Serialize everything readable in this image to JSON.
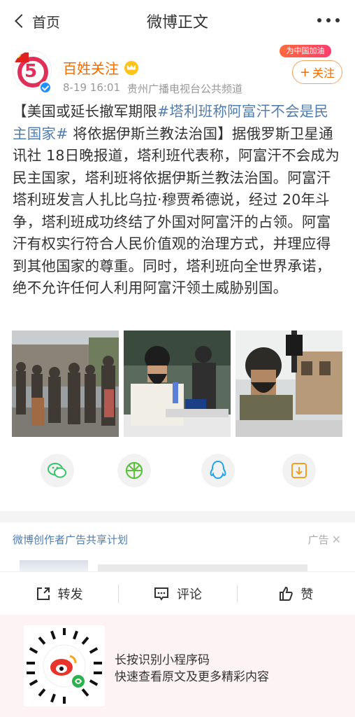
{
  "nav": {
    "back_label": "首页",
    "title": "微博正文"
  },
  "post": {
    "author": "百姓关注",
    "badge": "为中国加油",
    "follow_label": "关注",
    "date": "8-19 16:01",
    "source": "贵州广播电视台公共频道",
    "text_prefix": "【美国或延长撤军期限",
    "topic": "#塔利班称阿富汗不会是民主国家#",
    "text_body": " 将依据伊斯兰教法治国】据俄罗斯卫星通讯社 18日晚报道，塔利班代表称，阿富汗不会成为民主国家，塔利班将依据伊斯兰教法治国。阿富汗塔利班发言人扎比乌拉·穆贾希德说，经过 20年斗争，塔利班成功终结了外国对阿富汗的占领。阿富汗有权实行符合人民价值观的治理方式，并理应得到其他国家的尊重。同时，塔利班向全世界承诺，绝不允许任何人利用阿富汗领土威胁别国。",
    "share_icons": [
      "wechat-icon",
      "moments-icon",
      "qq-icon",
      "save-image-icon"
    ]
  },
  "ad": {
    "label": "微博创作者广告共享计划",
    "tag": "广告"
  },
  "actions": {
    "repost": "转发",
    "comment": "评论",
    "like": "赞"
  },
  "footer": {
    "line1": "长按识别小程序码",
    "line2": "快速查看原文及更多精彩内容"
  },
  "colors": {
    "accent_orange": "#f56b00",
    "topic_blue": "#507daf",
    "footer_bg": "#fdf3f5"
  }
}
